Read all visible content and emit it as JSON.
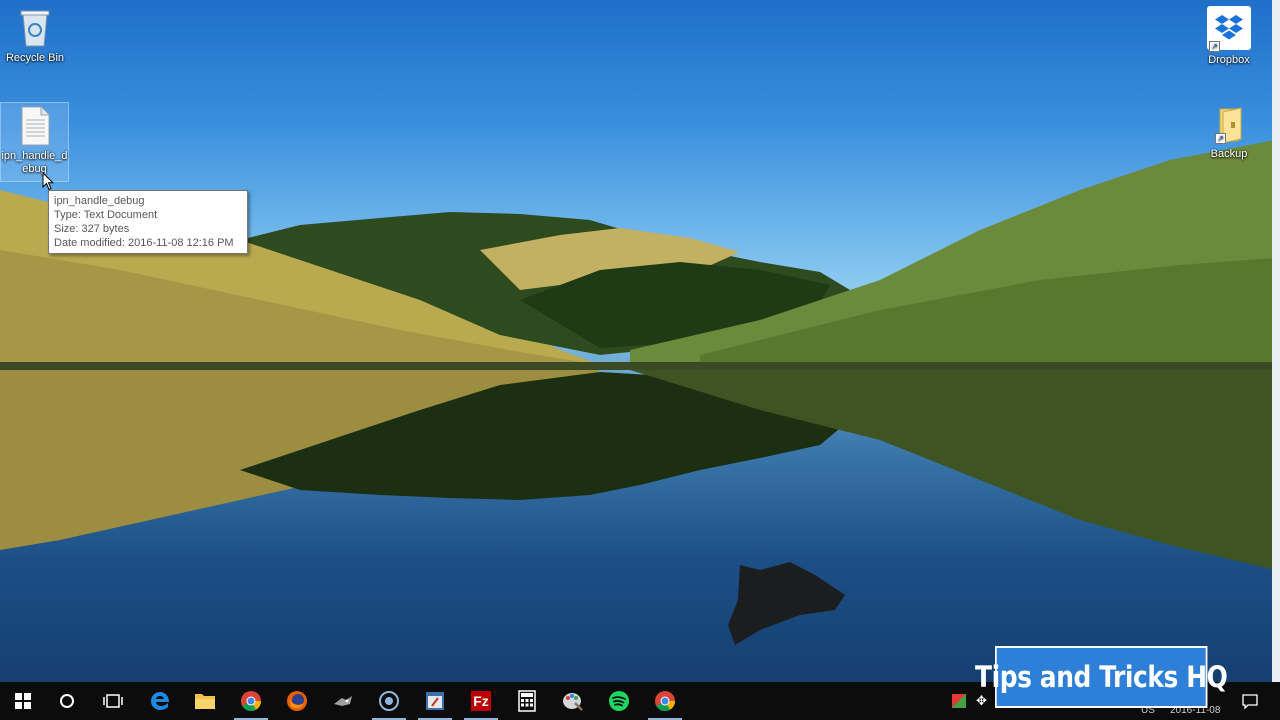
{
  "desktop": {
    "icons": {
      "recycle_bin": "Recycle Bin",
      "debug_file_line1": "ipn_handle_d",
      "debug_file_line2": "ebug",
      "dropbox": "Dropbox",
      "backup": "Backup"
    },
    "tooltip": {
      "name": "ipn_handle_debug",
      "type": "Type: Text Document",
      "size": "Size: 327 bytes",
      "modified": "Date modified: 2016-11-08 12:16 PM"
    }
  },
  "taskbar": {
    "items": [
      "start-icon",
      "cortana-icon",
      "task-view-icon",
      "edge-icon",
      "file-explorer-icon",
      "chrome-icon",
      "firefox-icon",
      "app-icon",
      "cortana-circle-icon",
      "app-window-icon",
      "filezilla-icon",
      "calculator-icon",
      "paint-icon",
      "spotify-icon",
      "chrome-icon"
    ],
    "tray": {
      "language": "US",
      "date": "2016-11-08"
    }
  },
  "watermark": {
    "text": "Tips and Tricks HQ"
  },
  "colors": {
    "taskbar": "#0c0c0c",
    "watermark_bg": "#2d7fd8",
    "sky_top": "#1f6fc9"
  }
}
